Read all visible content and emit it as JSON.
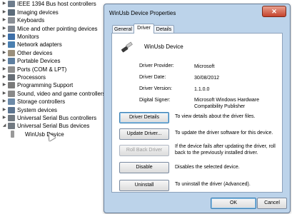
{
  "tree": {
    "nodes": [
      {
        "label": "IEEE 1394 Bus host controllers",
        "icon": "ieee1394-icon",
        "color": "#6d7c8c",
        "expanded": false
      },
      {
        "label": "Imaging devices",
        "icon": "camera-icon",
        "color": "#5b6b7a",
        "expanded": false
      },
      {
        "label": "Keyboards",
        "icon": "keyboard-icon",
        "color": "#8a8f96",
        "expanded": false
      },
      {
        "label": "Mice and other pointing devices",
        "icon": "mouse-icon",
        "color": "#7d8590",
        "expanded": false
      },
      {
        "label": "Monitors",
        "icon": "monitor-icon",
        "color": "#3d6fa8",
        "expanded": false
      },
      {
        "label": "Network adapters",
        "icon": "network-icon",
        "color": "#4a7fb0",
        "expanded": false
      },
      {
        "label": "Other devices",
        "icon": "other-devices-icon",
        "color": "#9a8f7c",
        "expanded": false
      },
      {
        "label": "Portable Devices",
        "icon": "portable-device-icon",
        "color": "#5e7fa0",
        "expanded": false
      },
      {
        "label": "Ports (COM & LPT)",
        "icon": "port-icon",
        "color": "#8e8e8e",
        "expanded": false
      },
      {
        "label": "Processors",
        "icon": "processor-icon",
        "color": "#666d75",
        "expanded": false
      },
      {
        "label": "Programming Support",
        "icon": "programming-icon",
        "color": "#7a7a7a",
        "expanded": false
      },
      {
        "label": "Sound, video and game controllers",
        "icon": "speaker-icon",
        "color": "#8a8a8a",
        "expanded": false
      },
      {
        "label": "Storage controllers",
        "icon": "storage-icon",
        "color": "#6c8aa8",
        "expanded": false
      },
      {
        "label": "System devices",
        "icon": "system-icon",
        "color": "#5d7590",
        "expanded": false
      },
      {
        "label": "Universal Serial Bus controllers",
        "icon": "usb-icon",
        "color": "#727a82",
        "expanded": false
      },
      {
        "label": "Universal Serial Bus devices",
        "icon": "usb-icon",
        "color": "#727a82",
        "expanded": true
      },
      {
        "label": "WinUsb Device",
        "icon": "usb-plug-icon",
        "color": "#999999",
        "child": true
      }
    ]
  },
  "dialog": {
    "title": "WinUsb Device Properties",
    "close_glyph": "✕",
    "tabs": [
      {
        "label": "General",
        "active": false
      },
      {
        "label": "Driver",
        "active": true
      },
      {
        "label": "Details",
        "active": false
      }
    ],
    "device_name": "WinUsb Device",
    "info": [
      {
        "label": "Driver Provider:",
        "value": "Microsoft"
      },
      {
        "label": "Driver Date:",
        "value": "30/08/2012"
      },
      {
        "label": "Driver Version:",
        "value": "1.1.0.0"
      },
      {
        "label": "Digital Signer:",
        "value": "Microsoft Windows Hardware Compatibility Publisher"
      }
    ],
    "actions": [
      {
        "button": "Driver Details",
        "desc": "To view details about the driver files.",
        "state": "focus"
      },
      {
        "button": "Update Driver...",
        "desc": "To update the driver software for this device.",
        "state": "normal"
      },
      {
        "button": "Roll Back Driver",
        "desc": "If the device fails after updating the driver, roll back to the previously installed driver.",
        "state": "disabled"
      },
      {
        "button": "Disable",
        "desc": "Disables the selected device.",
        "state": "normal"
      },
      {
        "button": "Uninstall",
        "desc": "To uninstall the driver (Advanced).",
        "state": "normal"
      }
    ],
    "ok_label": "OK",
    "cancel_label": "Cancel"
  }
}
